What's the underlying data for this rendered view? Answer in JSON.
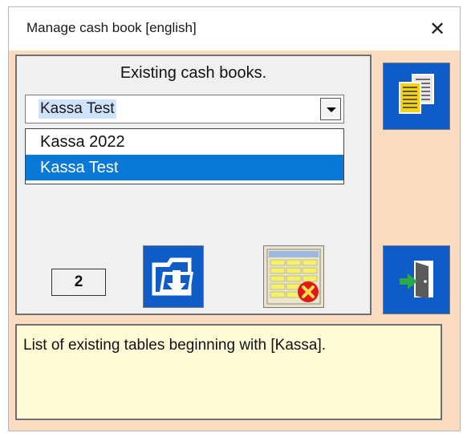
{
  "window": {
    "title": "Manage cash book [english]",
    "close_icon": "close-icon"
  },
  "group": {
    "label": "Existing cash books."
  },
  "combo": {
    "selected_value": "Kassa Test",
    "arrow_icon": "chevron-down-icon",
    "options": [
      "Kassa 2022",
      "Kassa Test"
    ],
    "selected_index": 1
  },
  "counter": {
    "value": "2"
  },
  "buttons": {
    "import_icon": "folder-download-icon",
    "delete_icon": "delete-table-icon",
    "copy_icon": "copy-documents-icon",
    "exit_icon": "exit-door-icon"
  },
  "info": {
    "text": "List of existing tables beginning with [Kassa]."
  },
  "colors": {
    "dialog_background": "#fcdcc0",
    "selection": "#0a78d7",
    "button_blue": "#0f5cc8",
    "info_background": "#fffbd7"
  }
}
